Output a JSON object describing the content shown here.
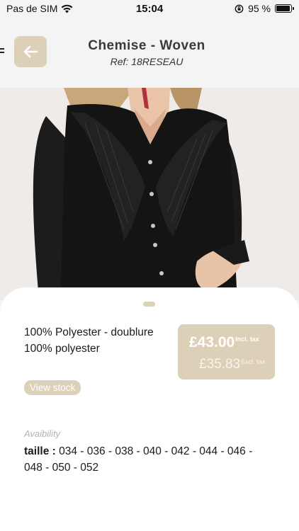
{
  "status_bar": {
    "carrier": "Pas de SIM",
    "time": "15:04",
    "battery_percent": "95 %",
    "battery_level": 0.95
  },
  "header": {
    "title": "Chemise - Woven",
    "ref": "Ref: 18RESEAU",
    "back_icon": "arrow-left-icon"
  },
  "product": {
    "composition_line1": "100% Polyester - doublure",
    "composition_line2": "100% polyester",
    "price_incl": "£43.00",
    "price_incl_label": "Incl. tax",
    "price_excl": "£35.83",
    "price_excl_label": "Excl. tax",
    "view_stock_label": "View stock",
    "availability_label": "Avaibility",
    "sizes_label": "taille :",
    "sizes_values": " 034 - 036 - 038 - 040 - 042 - 044 - 046 - 048 - 050 - 052"
  },
  "colors": {
    "accent": "#ddd0b9",
    "background": "#f4f4f5",
    "sheet": "#ffffff"
  }
}
